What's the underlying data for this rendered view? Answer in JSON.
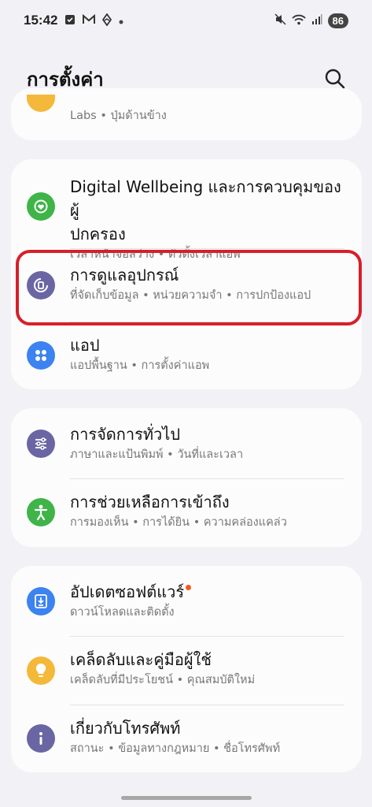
{
  "status_bar": {
    "time": "15:42",
    "battery": "86",
    "left_icons": [
      "message-icon",
      "gmail-icon",
      "messenger-icon",
      "dot-icon"
    ],
    "right_icons": [
      "mute-icon",
      "wifi-icon",
      "signal-icon"
    ]
  },
  "header": {
    "title": "การตั้งค่า",
    "search_icon": "search-icon"
  },
  "partial_card": {
    "subtitle": "Labs • ปุ่มด้านข้าง",
    "icon_color": "#f4b83a"
  },
  "card1": {
    "items": [
      {
        "title": "Digital Wellbeing และการควบคุมของผู้ปกครอง",
        "title_line1": "Digital Wellbeing และการควบคุมของผู้",
        "title_line2": "ปกครอง",
        "subtitle": "เวลาหน้าจอสว่าง • ตัวตั้งเวลาแอพ",
        "icon": "heart-icon",
        "icon_color": "#3fb449"
      },
      {
        "title": "การดูแลอุปกรณ์",
        "subtitle": "ที่จัดเก็บข้อมูล • หน่วยความจำ • การปกป้องแอป",
        "icon": "device-care-icon",
        "icon_color": "#6a66a3"
      },
      {
        "title": "แอป",
        "subtitle": "แอปพื้นฐาน • การตั้งค่าแอพ",
        "icon": "apps-icon",
        "icon_color": "#3c82f0"
      }
    ]
  },
  "card2": {
    "items": [
      {
        "title": "การจัดการทั่วไป",
        "subtitle": "ภาษาและแป้นพิมพ์ • วันที่และเวลา",
        "icon": "sliders-icon",
        "icon_color": "#6a66a3"
      },
      {
        "title": "การช่วยเหลือการเข้าถึง",
        "subtitle": "การมองเห็น • การได้ยิน • ความคล่องแคล่ว",
        "icon": "accessibility-icon",
        "icon_color": "#3fb449"
      }
    ]
  },
  "card3": {
    "items": [
      {
        "title": "อัปเดตซอฟต์แวร์",
        "subtitle": "ดาวน์โหลดและติดตั้ง",
        "icon": "download-icon",
        "icon_color": "#3c82f0",
        "badge_color": "#f05a22"
      },
      {
        "title": "เคล็ดลับและคู่มือผู้ใช้",
        "subtitle": "เคล็ดลับที่มีประโยชน์ • คุณสมบัติใหม่",
        "icon": "lightbulb-icon",
        "icon_color": "#f4b83a"
      },
      {
        "title": "เกี่ยวกับโทรศัพท์",
        "subtitle": "สถานะ • ข้อมูลทางกฎหมาย • ชื่อโทรศัพท์",
        "icon": "info-icon",
        "icon_color": "#6a66a3"
      }
    ]
  },
  "highlight_color": "#d81f2a"
}
